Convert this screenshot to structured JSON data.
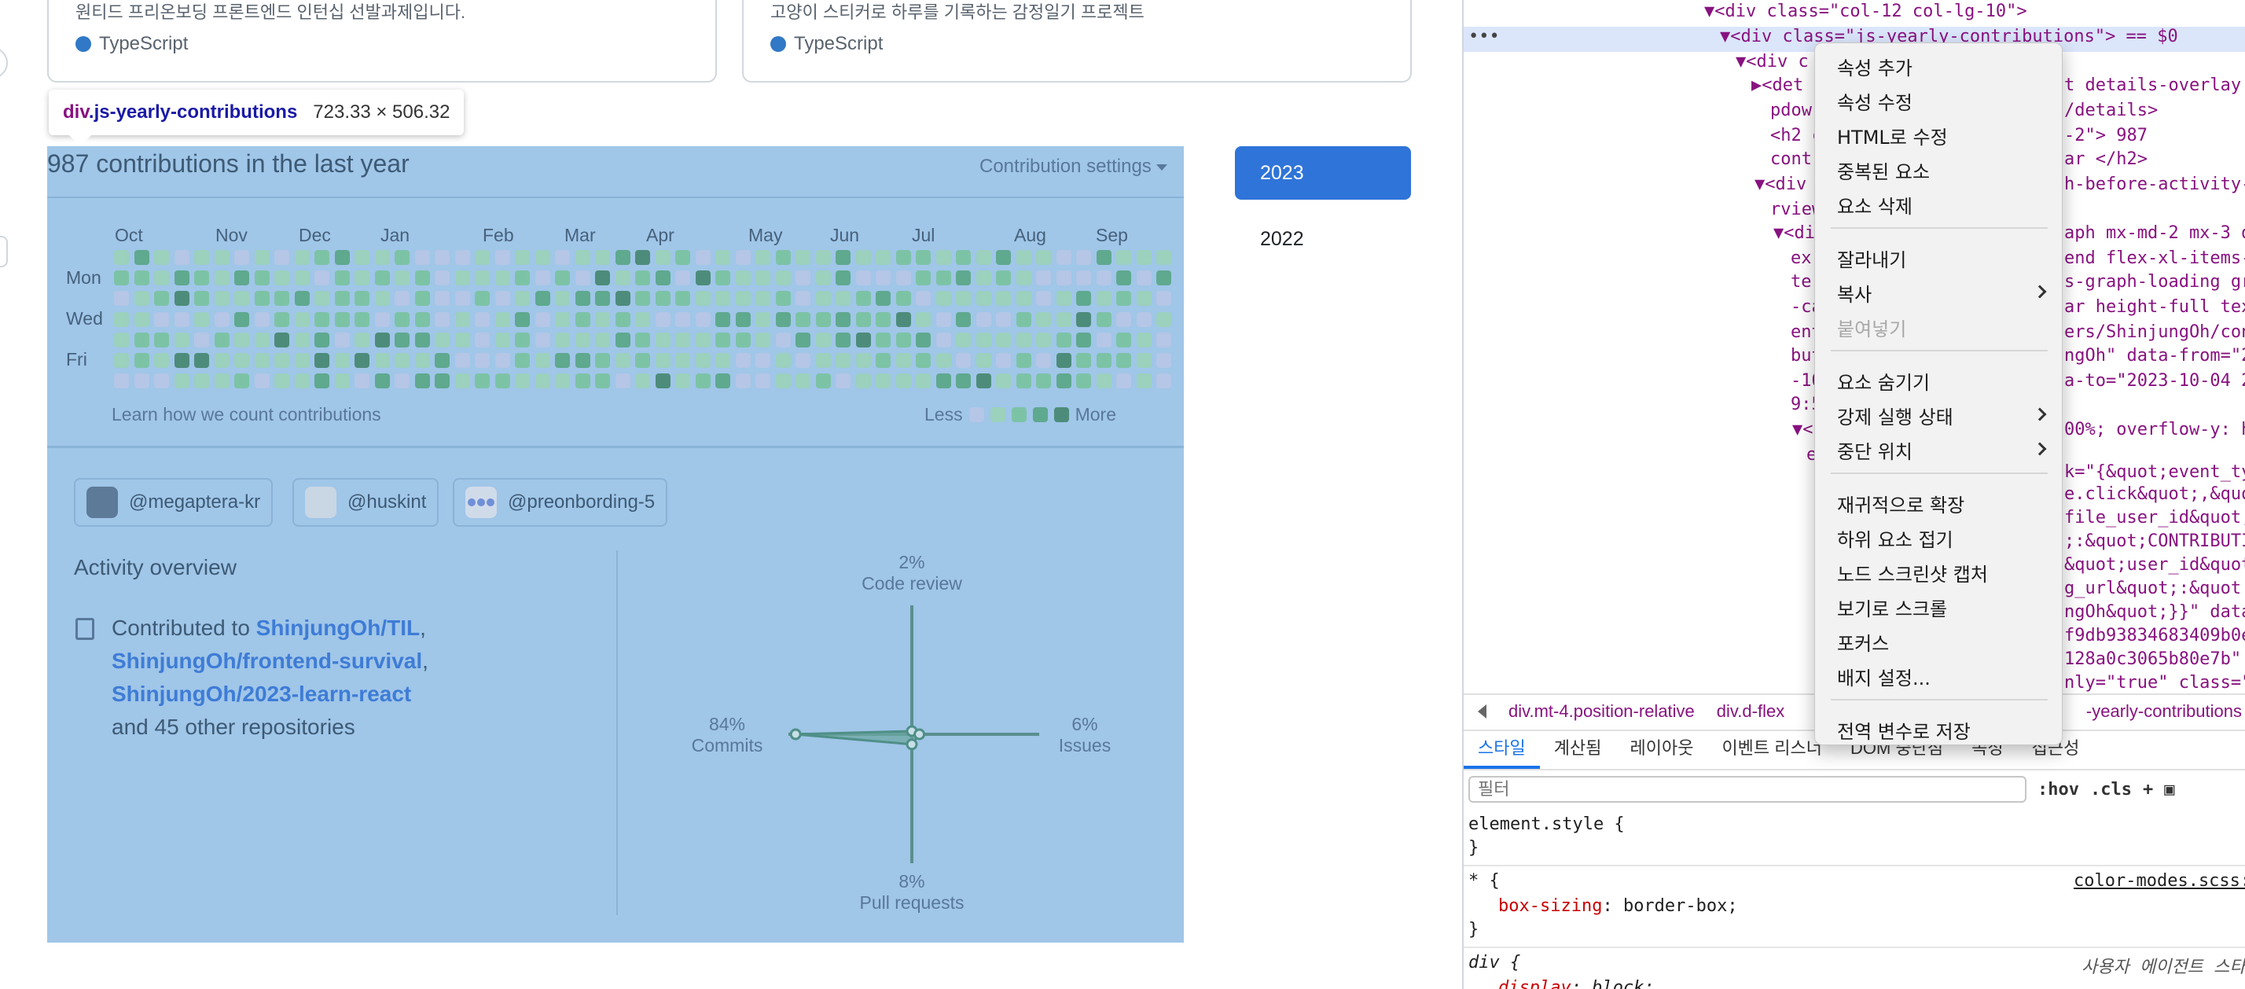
{
  "cards": [
    {
      "description": "원티드 프리온보딩 프론트엔드 인턴십 선발과제입니다.",
      "language": "TypeScript"
    },
    {
      "description": "고양이 스티커로 하루를 기록하는 감정일기 프로젝트",
      "language": "TypeScript"
    }
  ],
  "tooltip": {
    "tag": "div",
    "class_name": ".js-yearly-contributions",
    "dimensions": "723.33 × 506.32"
  },
  "contributions": {
    "title": "987 contributions in the last year",
    "settings_label": "Contribution settings",
    "months": [
      "Oct",
      "Nov",
      "Dec",
      "Jan",
      "Feb",
      "Mar",
      "Apr",
      "May",
      "Jun",
      "Jul",
      "Aug",
      "Sep"
    ],
    "days": [
      "Mon",
      "Wed",
      "Fri"
    ],
    "learn_link": "Learn how we count contributions",
    "legend_less": "Less",
    "legend_more": "More",
    "colors": [
      "#b5c6e6",
      "#9bd1bd",
      "#7cc3a6",
      "#5fa98f",
      "#4d8c7a"
    ]
  },
  "orgs": [
    "@megaptera-kr",
    "@huskint",
    "@preonbording-5"
  ],
  "activity": {
    "title": "Activity overview",
    "contributed_prefix": "Contributed to",
    "repos": [
      "ShinjungOh/TIL",
      "ShinjungOh/frontend-survival",
      "ShinjungOh/2023-learn-react"
    ],
    "others": "and 45 other repositories",
    "axes": {
      "code_review": {
        "pct": "2%",
        "label": "Code review",
        "value": 2
      },
      "issues": {
        "pct": "6%",
        "label": "Issues",
        "value": 6
      },
      "pull_requests": {
        "pct": "8%",
        "label": "Pull requests",
        "value": 8
      },
      "commits": {
        "pct": "84%",
        "label": "Commits",
        "value": 84
      }
    }
  },
  "years": [
    "2023",
    "2022"
  ],
  "devtools": {
    "code_lines": [
      {
        "t": "▼<div class=\"col-12 col-lg-10\">"
      },
      {
        "t": "▼<div class=\"js-yearly-contributions\"> == $0"
      },
      {
        "t": "▼<div c"
      },
      {
        "t": "▶<det"
      },
      {
        "t": "pdowr"
      },
      {
        "t": "<h2 c"
      },
      {
        "t": "contr"
      },
      {
        "t": "▼<div"
      },
      {
        "t": "rview"
      },
      {
        "t": "▼<di"
      },
      {
        "t": "ex"
      },
      {
        "t": "ter"
      },
      {
        "t": "-ca"
      },
      {
        "t": "ent"
      },
      {
        "t": "but"
      },
      {
        "t": "-10"
      },
      {
        "t": "9:5"
      },
      {
        "t": "▼<"
      },
      {
        "t": "e"
      },
      {
        "t": "▼"
      }
    ],
    "code_right": [
      "t details-overlay",
      "/details>",
      "-2\"> 987",
      "ar </h2>",
      "h-before-activity-",
      "aph mx-md-2 mx-3 d",
      "end flex-xl-items-",
      "s-graph-loading gr",
      "ar height-full tex",
      "ers/ShinjungOh/con",
      "ngOh\" data-from=\"2",
      "a-to=\"2023-10-04 2",
      "00%; overflow-y: h",
      "k=\"{&quot;event_typ",
      "e.click&quot;,&quot",
      "file_user_id&quot;",
      ";:&quot;CONTRIBUTI",
      "&quot;user_id&quot",
      "g_url&quot;:&quot",
      "ngOh&quot;}}\" data-",
      "f9db93834683409b0e",
      "128a0c3065b80e7b\"",
      "nly=\"true\" class=\""
    ],
    "breadcrumbs": [
      "div.mt-4.position-relative",
      "div.d-flex",
      "-yearly-contributions"
    ],
    "tabs": [
      "스타일",
      "계산됨",
      "레이아웃",
      "이벤트 리스너",
      "DOM 중단점",
      "속성",
      "접근성"
    ],
    "filter_placeholder": "필터",
    "hov": ":hov",
    "cls": ".cls",
    "styles": {
      "element_style": "element.style {",
      "close": "}",
      "star_rule": "* {",
      "star_prop": "box-sizing",
      "star_val": ": border-box;",
      "star_src": "color-modes.scss:",
      "div_rule": "div {",
      "div_src": "사용자 에이전트 스타일",
      "div_prop": "display",
      "div_val": ": block;"
    }
  },
  "context_menu": {
    "items": [
      {
        "label": "속성 추가"
      },
      {
        "label": "속성 수정"
      },
      {
        "label": "HTML로 수정"
      },
      {
        "label": "중복된 요소"
      },
      {
        "label": "요소 삭제"
      },
      {
        "label": "잘라내기"
      },
      {
        "label": "복사",
        "submenu": true
      },
      {
        "label": "붙여넣기",
        "disabled": true
      },
      {
        "label": "요소 숨기기"
      },
      {
        "label": "강제 실행 상태",
        "submenu": true
      },
      {
        "label": "중단 위치",
        "submenu": true
      },
      {
        "label": "재귀적으로 확장"
      },
      {
        "label": "하위 요소 접기"
      },
      {
        "label": "노드 스크린샷 캡처"
      },
      {
        "label": "보기로 스크롤"
      },
      {
        "label": "포커스"
      },
      {
        "label": "배지 설정..."
      },
      {
        "label": "전역 변수로 저장"
      }
    ]
  }
}
